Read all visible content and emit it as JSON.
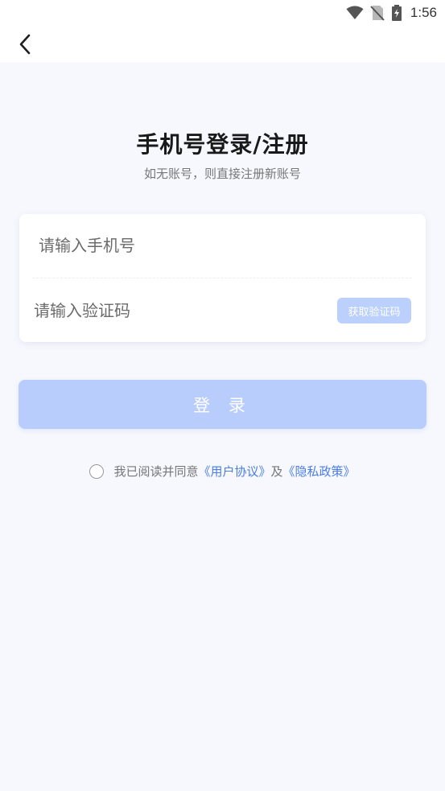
{
  "status_bar": {
    "time": "1:56",
    "icons": [
      "wifi-icon",
      "no-sim-icon",
      "battery-charging-icon"
    ]
  },
  "nav": {
    "back_icon": "chevron-left-icon"
  },
  "header": {
    "title": "手机号登录/注册",
    "subtitle": "如无账号，则直接注册新账号"
  },
  "form": {
    "phone_placeholder": "请输入手机号",
    "code_placeholder": "请输入验证码",
    "get_code_label": "获取验证码"
  },
  "login_button_label": "登 录",
  "agreement": {
    "prefix": "我已阅读并同意",
    "user_agreement": "《用户协议》",
    "connector": "及",
    "privacy_policy": "《隐私政策》"
  },
  "colors": {
    "accent": "#b9cdfc",
    "link": "#4a7de8",
    "background": "#f6f8fd"
  }
}
